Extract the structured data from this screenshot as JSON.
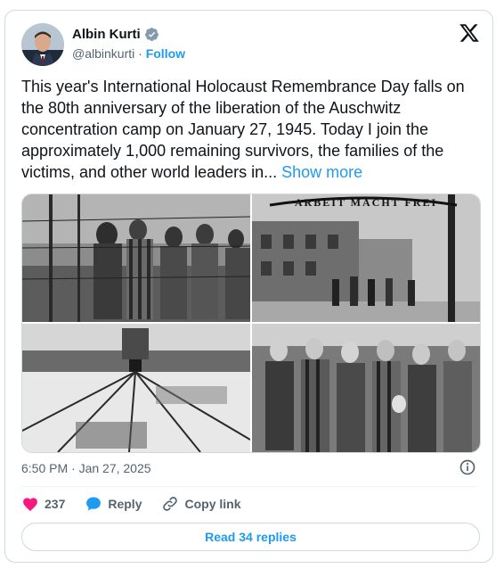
{
  "author": {
    "name": "Albin Kurti",
    "handle": "@albinkurti",
    "separator": "·",
    "follow_label": "Follow"
  },
  "tweet": {
    "text": "This year's International Holocaust Remembrance Day falls on the 80th anniversary of the liberation of the Auschwitz concentration camp on January 27, 1945. Today I join the approximately 1,000 remaining survivors, the families of the victims, and other world leaders in...",
    "show_more_label": "Show more",
    "timestamp": "6:50 PM · Jan 27, 2025",
    "photo_sign_text": "ARBEIT MACHT FREI"
  },
  "actions": {
    "like_count": "237",
    "reply_label": "Reply",
    "copy_link_label": "Copy link",
    "read_replies_label": "Read 34 replies"
  },
  "colors": {
    "accent": "#1d9bf0",
    "like": "#f91880",
    "muted": "#536471",
    "border": "#cfd9de"
  },
  "icons": [
    "verified-badge-icon",
    "x-logo-icon",
    "info-icon",
    "heart-icon",
    "reply-bubble-icon",
    "link-icon"
  ]
}
